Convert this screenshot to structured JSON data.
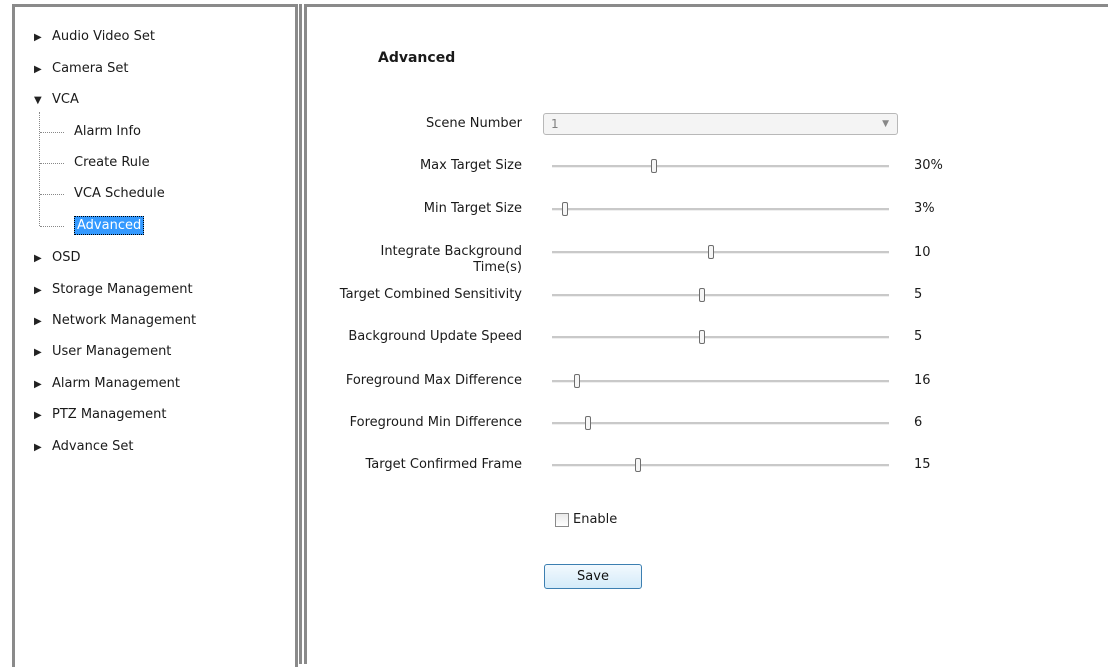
{
  "tree": {
    "items": [
      {
        "label": "Audio Video Set",
        "expanded": false
      },
      {
        "label": "Camera Set",
        "expanded": false
      },
      {
        "label": "VCA",
        "expanded": true,
        "children": [
          {
            "label": "Alarm Info"
          },
          {
            "label": "Create Rule"
          },
          {
            "label": "VCA Schedule"
          },
          {
            "label": "Advanced",
            "selected": true
          }
        ]
      },
      {
        "label": "OSD",
        "expanded": false
      },
      {
        "label": "Storage Management",
        "expanded": false
      },
      {
        "label": "Network Management",
        "expanded": false
      },
      {
        "label": "User Management",
        "expanded": false
      },
      {
        "label": "Alarm Management",
        "expanded": false
      },
      {
        "label": "PTZ Management",
        "expanded": false
      },
      {
        "label": "Advance Set",
        "expanded": false
      }
    ],
    "collapsed_icon": "triangle-right",
    "expanded_icon": "triangle-down"
  },
  "main": {
    "title": "Advanced",
    "scene_number": {
      "label": "Scene Number",
      "value": "1",
      "enabled": false
    },
    "sliders": [
      {
        "label": "Max Target Size",
        "value": "30%",
        "fraction": 0.3
      },
      {
        "label": "Min Target Size",
        "value": "3%",
        "fraction": 0.03
      },
      {
        "label": "Integrate Background",
        "label2": "Time(s)",
        "value": "10",
        "fraction": 0.47
      },
      {
        "label": "Target Combined Sensitivity",
        "value": "5",
        "fraction": 0.445
      },
      {
        "label": "Background Update Speed",
        "value": "5",
        "fraction": 0.445
      },
      {
        "label": "Foreground Max Difference",
        "value": "16",
        "fraction": 0.065
      },
      {
        "label": "Foreground Min Difference",
        "value": "6",
        "fraction": 0.1
      },
      {
        "label": "Target Confirmed Frame",
        "value": "15",
        "fraction": 0.25
      }
    ],
    "enable": {
      "label": "Enable",
      "checked": false
    },
    "save_label": "Save"
  },
  "colors": {
    "selection": "#3399ff",
    "frame_border": "#8a8a8a",
    "button_border": "#3c7fb1"
  }
}
